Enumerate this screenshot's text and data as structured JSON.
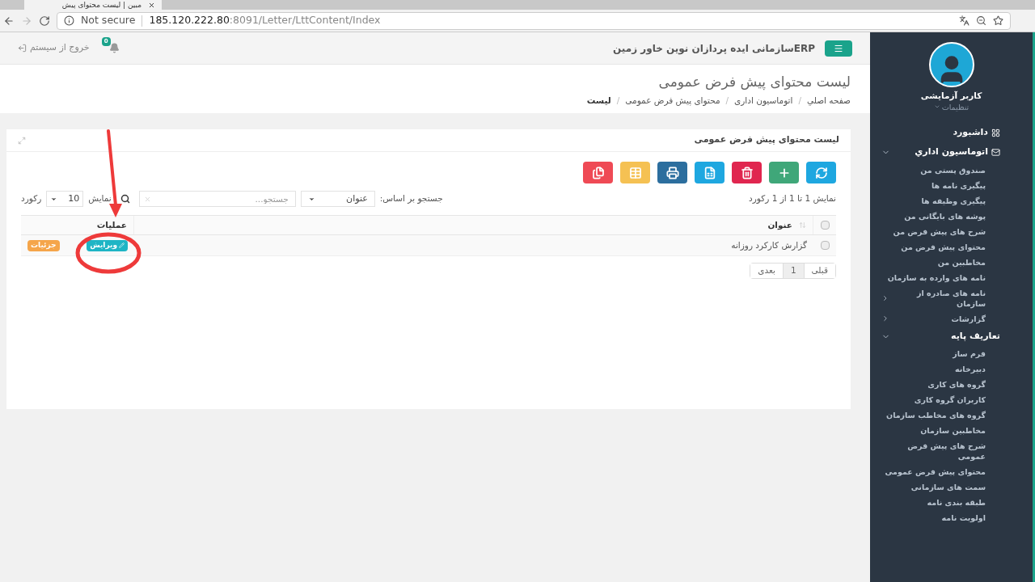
{
  "browser": {
    "tab_title": "مبین | لیست محتوای پیش",
    "security": "Not secure",
    "url_host": "185.120.222.80",
    "url_path": ":8091/Letter/LttContent/Index"
  },
  "topbar": {
    "brand": "ERPسازمانی ایده پردازان نوین خاور زمین",
    "notifications": "0",
    "logout": "خروج از سیستم"
  },
  "page": {
    "title": "لیست محتوای پیش فرض عمومی",
    "breadcrumb_separator": "/",
    "breadcrumb": [
      "صفحه اصلي",
      "اتوماسیون اداری",
      "محتوای پیش فرض عمومی",
      "لیست"
    ]
  },
  "card": {
    "title": "لیست محتوای پیش فرض عمومی",
    "toolbar": [
      {
        "kind": "refresh",
        "color": "#1ea7e0"
      },
      {
        "kind": "add",
        "color": "#3fa779"
      },
      {
        "kind": "delete",
        "color": "#e0264f"
      },
      {
        "kind": "excel",
        "color": "#1ea7e0"
      },
      {
        "kind": "print",
        "color": "#2c6e9e"
      },
      {
        "kind": "columns",
        "color": "#f5c153"
      },
      {
        "kind": "copy",
        "color": "#ef4a55"
      }
    ],
    "summary": "نمایش 1 تا 1 از 1 رکورد",
    "search_by_label": "جستجو بر اساس:",
    "search_by": "عنوان",
    "search": {
      "placeholder": "جستجو..."
    },
    "show_label": "نمایش",
    "page_size": "10",
    "records_label": "رکورد",
    "table": {
      "header_checked": false,
      "columns": [
        "عنوان",
        "عملیات"
      ],
      "rows": [
        {
          "checked": false,
          "title": "گزارش کارکرد روزانه",
          "actions": [
            {
              "kind": "edit",
              "label": "ویرایش"
            },
            {
              "kind": "details",
              "label": "جزئیات"
            }
          ]
        }
      ]
    },
    "pagination": [
      {
        "label": "قبلی",
        "selected": false
      },
      {
        "label": "1",
        "selected": true
      },
      {
        "label": "بعدی",
        "selected": false
      }
    ]
  },
  "sidebar": {
    "user": "کاربر آزمایشی",
    "settings": "تنظیمات",
    "items": [
      {
        "kind": "dashboard",
        "label": "داشبورد"
      },
      {
        "kind": "mail",
        "label": "اتوماسیون اداري",
        "expanded": true,
        "children": [
          {
            "label": "صندوق پستی من"
          },
          {
            "label": "پیگیری نامه ها"
          },
          {
            "label": "پیگیری وظیفه ها"
          },
          {
            "label": "پوشه های بایگانی من"
          },
          {
            "label": "شرح های پیش فرض من"
          },
          {
            "label": "محتوای پیش فرض من"
          },
          {
            "label": "مخاطبین من"
          },
          {
            "label": "نامه های وارده به سازمان"
          },
          {
            "label": "نامه های صادره از سازمان",
            "expanded": false
          },
          {
            "label": "گزارشات",
            "expanded": false
          }
        ]
      },
      {
        "kind": "plain",
        "label": "تعاریف پایه",
        "expanded": true,
        "children": [
          {
            "label": "فرم ساز"
          },
          {
            "label": "دبیرخانه"
          },
          {
            "label": "گروه های کاری"
          },
          {
            "label": "کاربران گروه کاری"
          },
          {
            "label": "گروه های مخاطب سازمان"
          },
          {
            "label": "مخاطبین سازمان"
          },
          {
            "label": "شرح های پیش فرض عمومی"
          },
          {
            "label": "محتوای پیش فرض عمومی"
          },
          {
            "label": "سمت های سازمانی"
          },
          {
            "label": "طبقه بندی نامه"
          },
          {
            "label": "اولویت نامه"
          }
        ]
      }
    ]
  }
}
